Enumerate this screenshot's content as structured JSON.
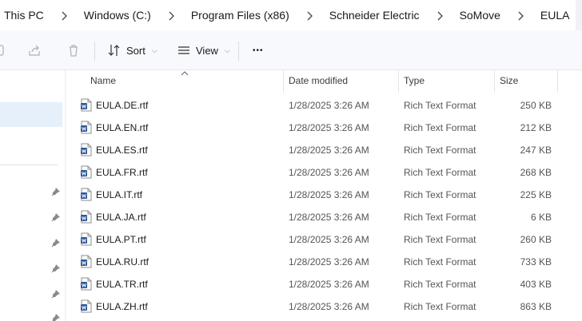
{
  "breadcrumb": [
    {
      "label": "This PC"
    },
    {
      "label": "Windows (C:)"
    },
    {
      "label": "Program Files (x86)"
    },
    {
      "label": "Schneider Electric"
    },
    {
      "label": "SoMove"
    },
    {
      "label": "EULA"
    }
  ],
  "toolbar": {
    "sort_label": "Sort",
    "view_label": "View",
    "more_label": "•••"
  },
  "columns": {
    "name": "Name",
    "date": "Date modified",
    "type": "Type",
    "size": "Size"
  },
  "files": [
    {
      "name": "EULA.DE.rtf",
      "date": "1/28/2025 3:26 AM",
      "type": "Rich Text Format",
      "size": "250 KB"
    },
    {
      "name": "EULA.EN.rtf",
      "date": "1/28/2025 3:26 AM",
      "type": "Rich Text Format",
      "size": "212 KB"
    },
    {
      "name": "EULA.ES.rtf",
      "date": "1/28/2025 3:26 AM",
      "type": "Rich Text Format",
      "size": "247 KB"
    },
    {
      "name": "EULA.FR.rtf",
      "date": "1/28/2025 3:26 AM",
      "type": "Rich Text Format",
      "size": "268 KB"
    },
    {
      "name": "EULA.IT.rtf",
      "date": "1/28/2025 3:26 AM",
      "type": "Rich Text Format",
      "size": "225 KB"
    },
    {
      "name": "EULA.JA.rtf",
      "date": "1/28/2025 3:26 AM",
      "type": "Rich Text Format",
      "size": "6 KB"
    },
    {
      "name": "EULA.PT.rtf",
      "date": "1/28/2025 3:26 AM",
      "type": "Rich Text Format",
      "size": "260 KB"
    },
    {
      "name": "EULA.RU.rtf",
      "date": "1/28/2025 3:26 AM",
      "type": "Rich Text Format",
      "size": "733 KB"
    },
    {
      "name": "EULA.TR.rtf",
      "date": "1/28/2025 3:26 AM",
      "type": "Rich Text Format",
      "size": "403 KB"
    },
    {
      "name": "EULA.ZH.rtf",
      "date": "1/28/2025 3:26 AM",
      "type": "Rich Text Format",
      "size": "863 KB"
    }
  ],
  "icons": {
    "file": "word-document-icon",
    "pin": "pin-icon"
  },
  "colors": {
    "accent": "#2b579a",
    "selection": "#e5f0fb"
  }
}
